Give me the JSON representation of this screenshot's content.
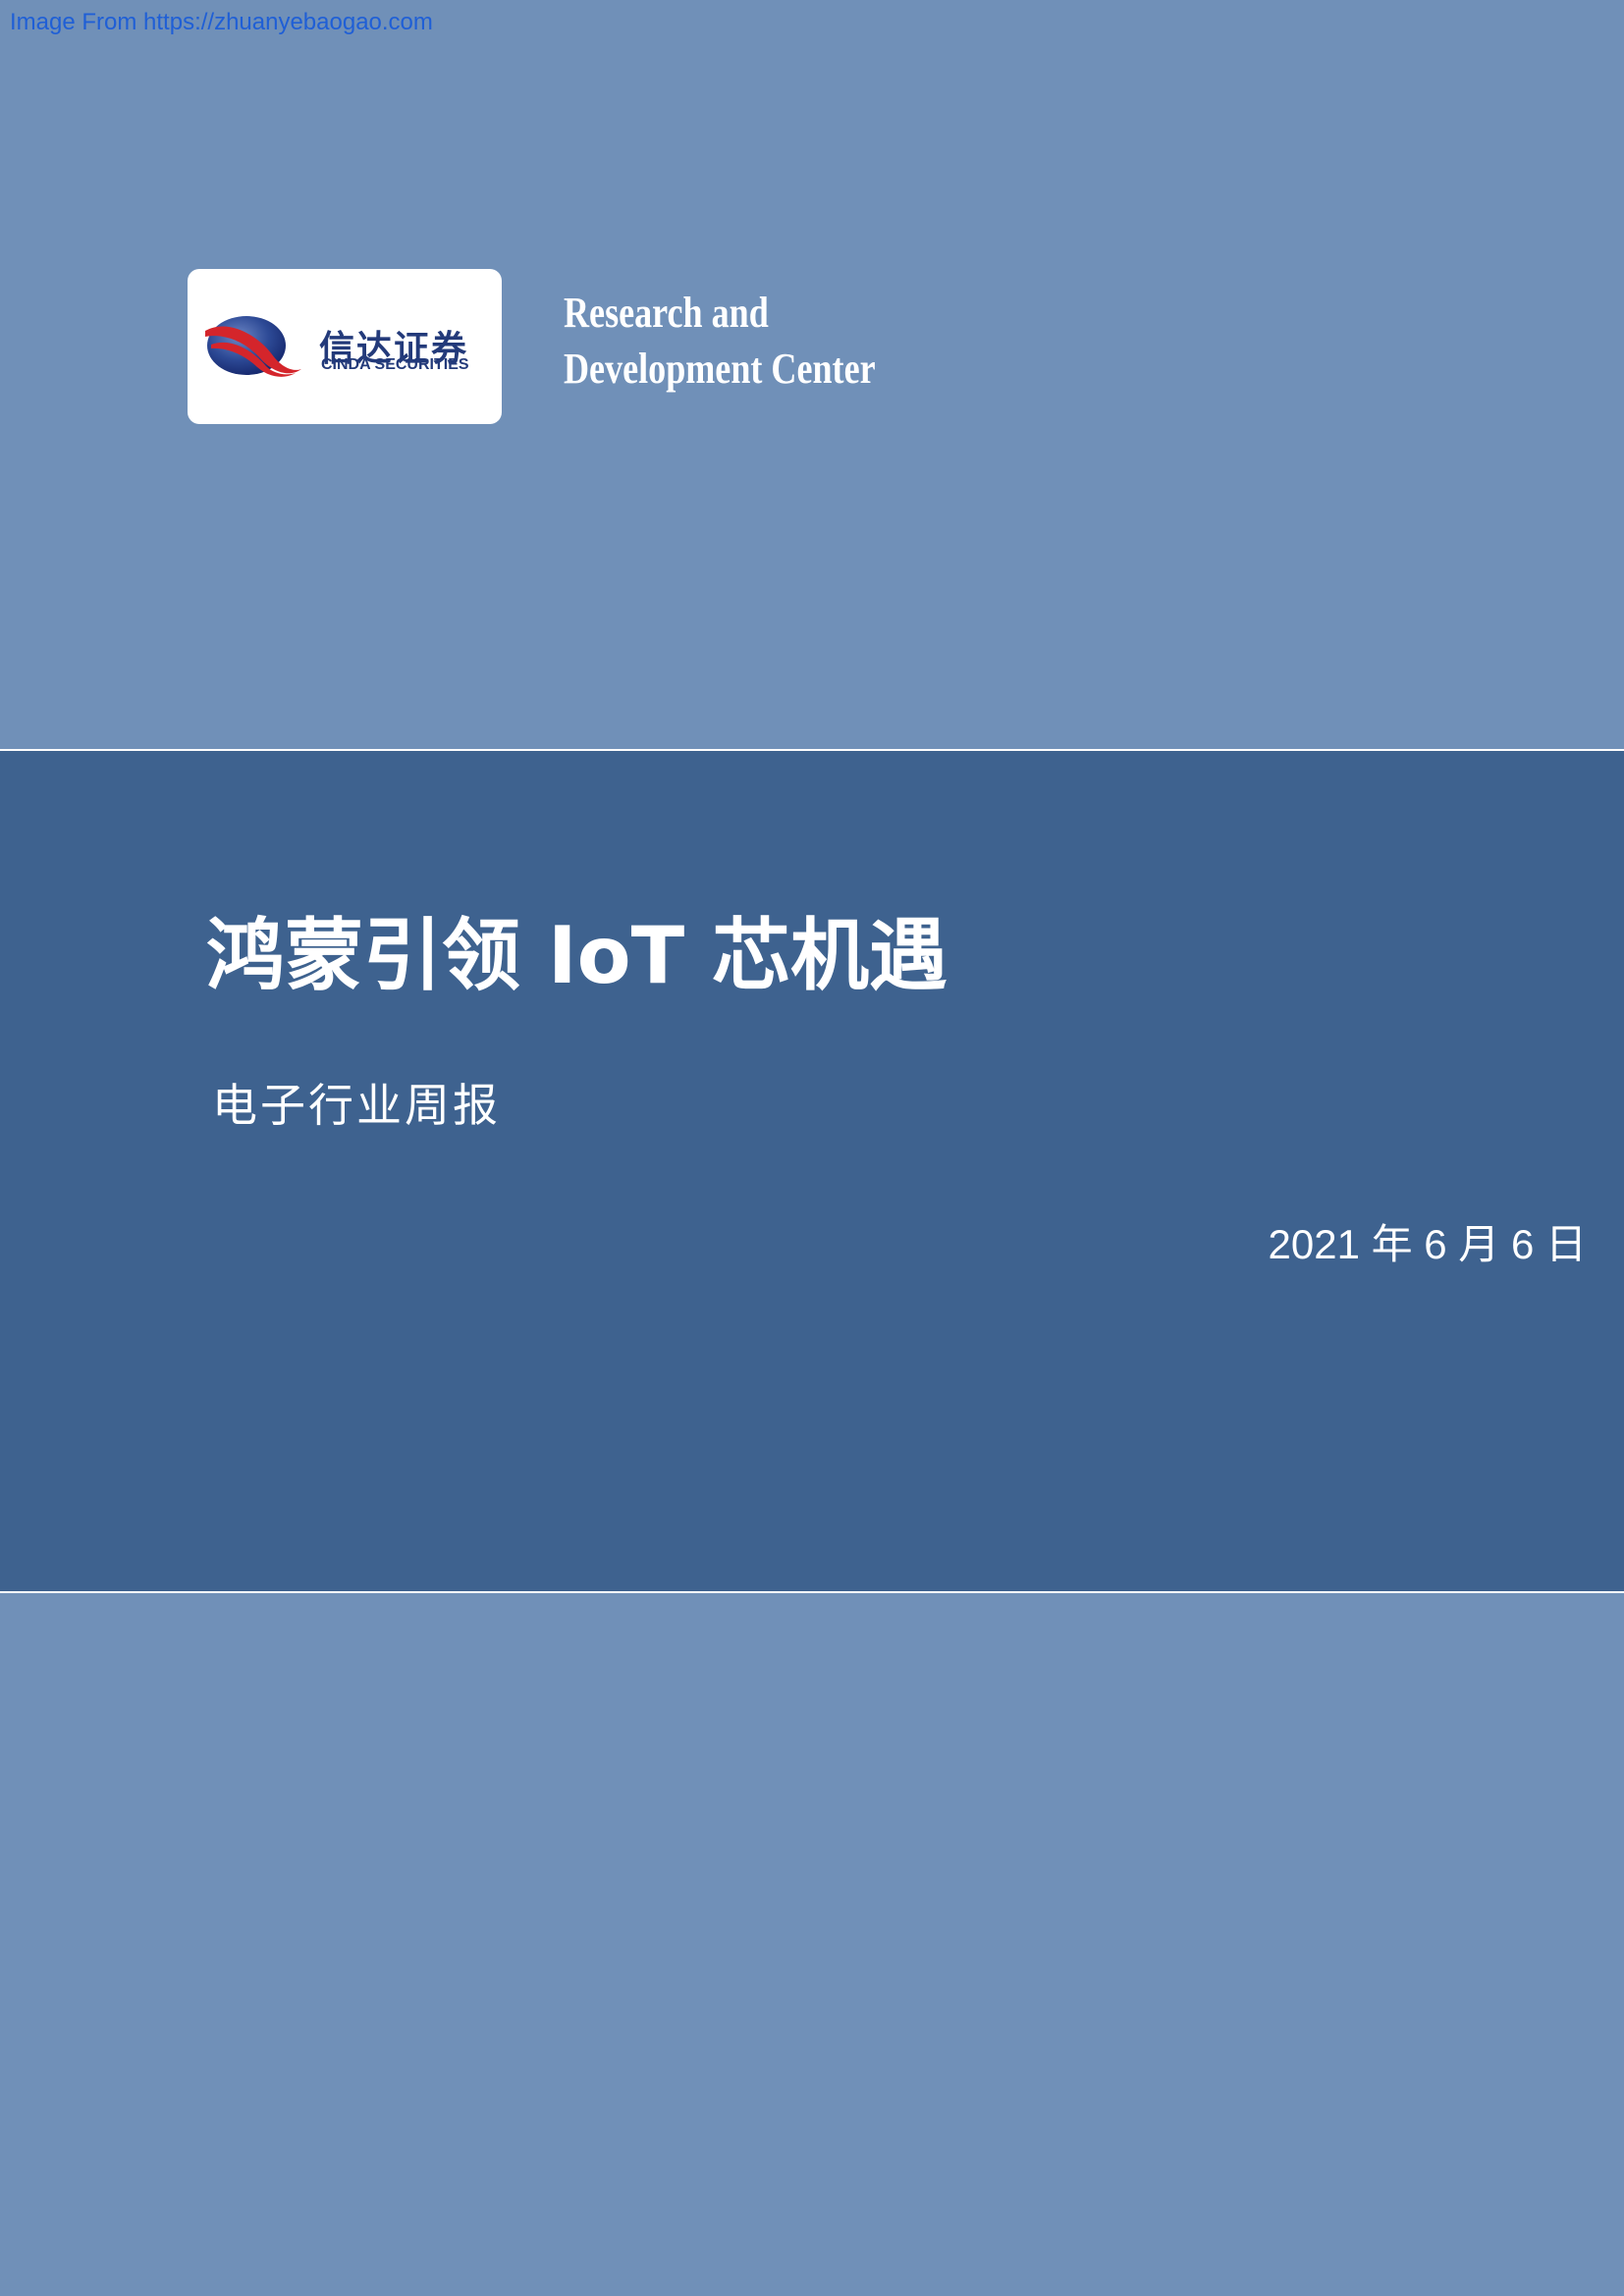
{
  "source_link": "Image From https://zhuanyebaogao.com",
  "logo": {
    "name_cn": "信达证券",
    "name_en": "CINDA SECURITIES",
    "icon": "cinda-logo-icon",
    "colors": {
      "navy": "#233a7a",
      "red": "#d4252b"
    }
  },
  "center_name": {
    "line1": "Research and",
    "line2": "Development Center"
  },
  "report": {
    "title": "鸿蒙引领 IoT 芯机遇",
    "subtitle": "电子行业周报",
    "date": "2021 年 6 月 6 日"
  },
  "colors": {
    "light_band": "#7090b8",
    "dark_band": "#3e628f",
    "link": "#1f5fd6",
    "text": "#ffffff"
  }
}
